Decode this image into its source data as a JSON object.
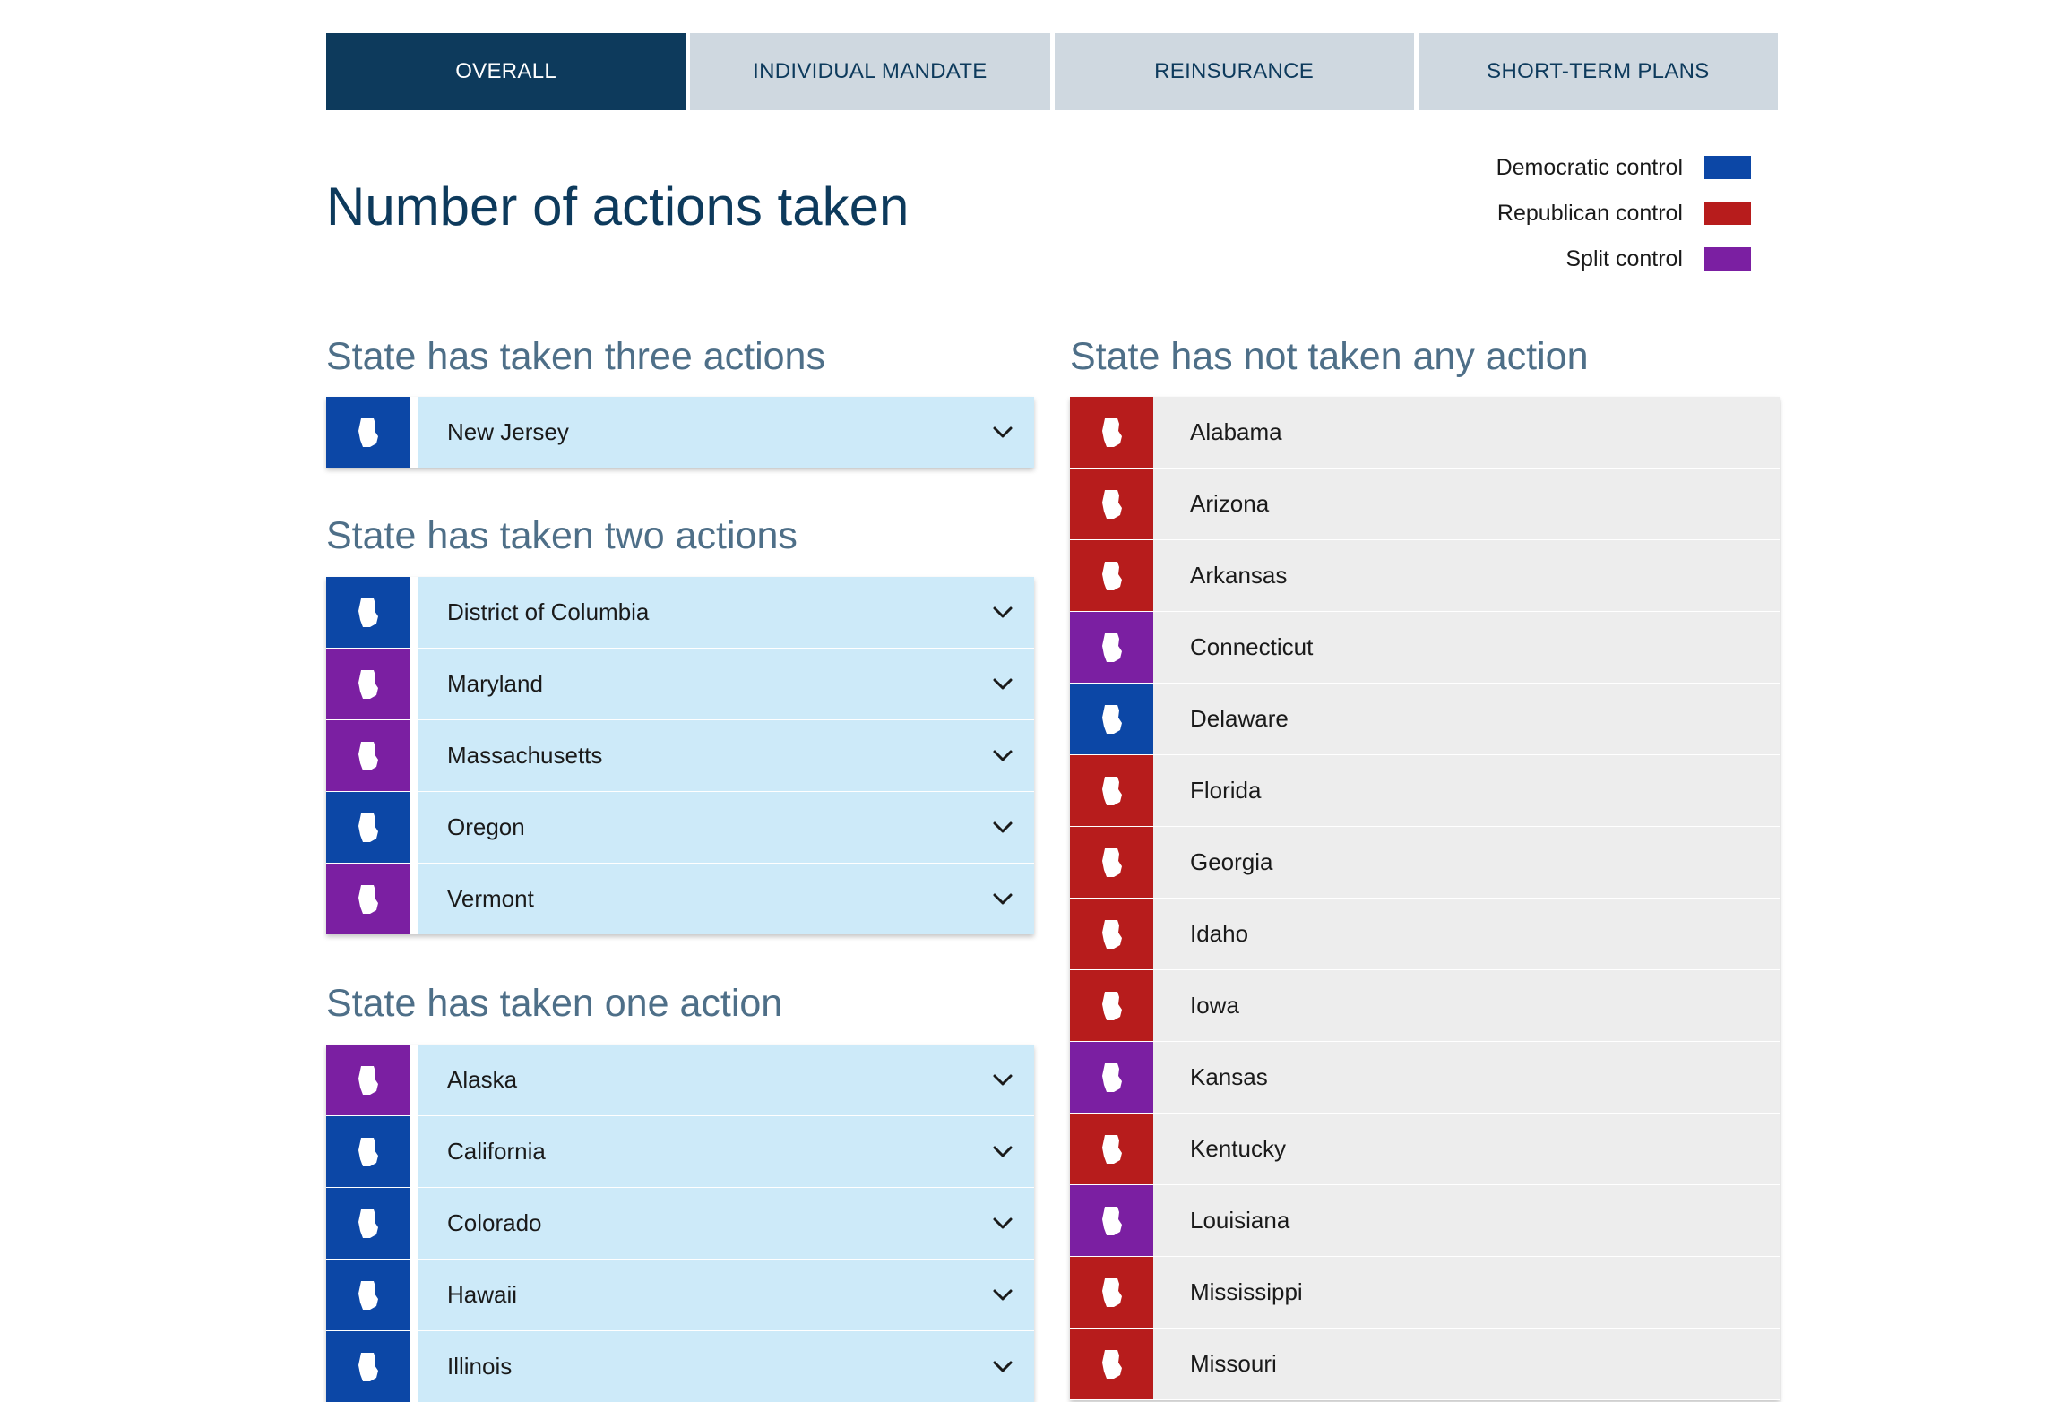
{
  "tabs": [
    {
      "label": "OVERALL",
      "active": true
    },
    {
      "label": "INDIVIDUAL MANDATE",
      "active": false
    },
    {
      "label": "REINSURANCE",
      "active": false
    },
    {
      "label": "SHORT-TERM PLANS",
      "active": false
    }
  ],
  "page_title": "Number of actions taken",
  "legend": [
    {
      "label": "Democratic control",
      "color": "#0c47a6"
    },
    {
      "label": "Republican control",
      "color": "#b71c1c"
    },
    {
      "label": "Split control",
      "color": "#7b1fa2"
    }
  ],
  "colors": {
    "D": "#0c47a6",
    "R": "#b71c1c",
    "S": "#7b1fa2"
  },
  "sections": {
    "three": {
      "title": "State has taken three actions",
      "states": [
        {
          "name": "New Jersey",
          "control": "D",
          "icon": "new-jersey-shape-icon"
        }
      ]
    },
    "two": {
      "title": "State has taken two actions",
      "states": [
        {
          "name": "District of Columbia",
          "control": "D",
          "icon": "district-of-columbia-shape-icon"
        },
        {
          "name": "Maryland",
          "control": "S",
          "icon": "maryland-shape-icon"
        },
        {
          "name": "Massachusetts",
          "control": "S",
          "icon": "massachusetts-shape-icon"
        },
        {
          "name": "Oregon",
          "control": "D",
          "icon": "oregon-shape-icon"
        },
        {
          "name": "Vermont",
          "control": "S",
          "icon": "vermont-shape-icon"
        }
      ]
    },
    "one": {
      "title": "State has taken one action",
      "states": [
        {
          "name": "Alaska",
          "control": "S",
          "icon": "alaska-shape-icon"
        },
        {
          "name": "California",
          "control": "D",
          "icon": "california-shape-icon"
        },
        {
          "name": "Colorado",
          "control": "D",
          "icon": "colorado-shape-icon"
        },
        {
          "name": "Hawaii",
          "control": "D",
          "icon": "hawaii-shape-icon"
        },
        {
          "name": "Illinois",
          "control": "D",
          "icon": "illinois-shape-icon"
        }
      ]
    },
    "none": {
      "title": "State has not taken any action",
      "states": [
        {
          "name": "Alabama",
          "control": "R",
          "icon": "alabama-shape-icon"
        },
        {
          "name": "Arizona",
          "control": "R",
          "icon": "arizona-shape-icon"
        },
        {
          "name": "Arkansas",
          "control": "R",
          "icon": "arkansas-shape-icon"
        },
        {
          "name": "Connecticut",
          "control": "S",
          "icon": "connecticut-shape-icon"
        },
        {
          "name": "Delaware",
          "control": "D",
          "icon": "delaware-shape-icon"
        },
        {
          "name": "Florida",
          "control": "R",
          "icon": "florida-shape-icon"
        },
        {
          "name": "Georgia",
          "control": "R",
          "icon": "georgia-shape-icon"
        },
        {
          "name": "Idaho",
          "control": "R",
          "icon": "idaho-shape-icon"
        },
        {
          "name": "Iowa",
          "control": "R",
          "icon": "iowa-shape-icon"
        },
        {
          "name": "Kansas",
          "control": "S",
          "icon": "kansas-shape-icon"
        },
        {
          "name": "Kentucky",
          "control": "R",
          "icon": "kentucky-shape-icon"
        },
        {
          "name": "Louisiana",
          "control": "S",
          "icon": "louisiana-shape-icon"
        },
        {
          "name": "Mississippi",
          "control": "R",
          "icon": "mississippi-shape-icon"
        },
        {
          "name": "Missouri",
          "control": "R",
          "icon": "missouri-shape-icon"
        }
      ]
    }
  }
}
